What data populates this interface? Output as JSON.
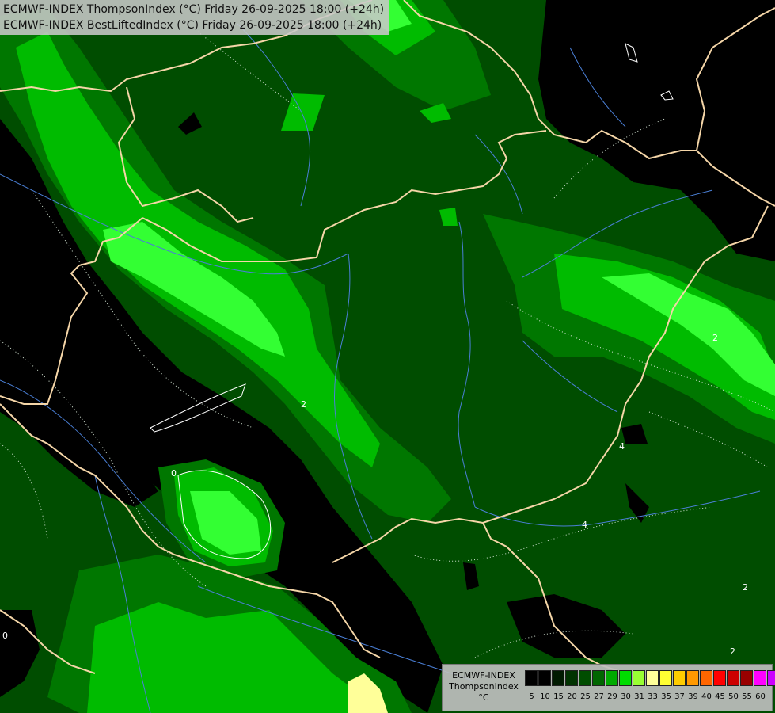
{
  "title": {
    "line1": "ECMWF-INDEX ThompsonIndex (°C) Friday 26-09-2025 18:00 (+24h)",
    "line2": "ECMWF-INDEX BestLiftedIndex (°C) Friday 26-09-2025 18:00 (+24h)"
  },
  "legend": {
    "source": "ECMWF-INDEX",
    "parameter": "ThompsonIndex",
    "unit": "°C",
    "ticks": [
      "5",
      "10",
      "15",
      "20",
      "25",
      "27",
      "29",
      "30",
      "31",
      "33",
      "35",
      "37",
      "39",
      "40",
      "45",
      "50",
      "55",
      "60"
    ],
    "colors": [
      "#000000",
      "#000000",
      "#001a00",
      "#003300",
      "#004d00",
      "#006600",
      "#00aa00",
      "#00dd00",
      "#99ff33",
      "#ffff99",
      "#ffff33",
      "#ffcc00",
      "#ff9900",
      "#ff6600",
      "#ff0000",
      "#cc0000",
      "#990000",
      "#ff00ff",
      "#cc00ff",
      "#9900ff",
      "#6600ff",
      "#0000ff"
    ]
  },
  "contour_labels": [
    "2",
    "2",
    "0",
    "4",
    "4",
    "2",
    "0",
    "2"
  ],
  "palette": {
    "black": "#000000",
    "dark_green": "#004d00",
    "mid_green": "#006600",
    "green": "#00aa00",
    "bright_green": "#00dd00",
    "light_green": "#33ff33",
    "yellow": "#ffff99",
    "border": "#f5d6a8",
    "river": "#4a7fd6"
  }
}
